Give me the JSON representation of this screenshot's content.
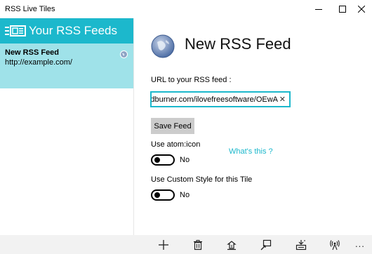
{
  "window": {
    "title": "RSS Live Tiles"
  },
  "sidebar": {
    "header_title": "Your RSS Feeds",
    "header_icon": "news-icon",
    "items": [
      {
        "name": "New RSS Feed",
        "url": "http://example.com/",
        "icon": "globe-icon"
      }
    ]
  },
  "main": {
    "title": "New RSS Feed",
    "url_label": "URL to your RSS feed :",
    "url_value": "http://feeds.feedburner.com/ilovefreesoftware/OEwA",
    "save_label": "Save Feed",
    "atom_label": "Use atom:icon",
    "whats_this": "What's this ?",
    "atom_state": "No",
    "custom_label": "Use Custom Style for this Tile",
    "custom_state": "No"
  },
  "appbar": {
    "icons": [
      "add-icon",
      "delete-icon",
      "pin-icon",
      "preview-icon",
      "tile-icon",
      "antenna-icon"
    ],
    "more": "..."
  },
  "colors": {
    "accent": "#1cb8cc",
    "selection": "#9fe2e9",
    "appbar": "#f2f2f2",
    "link": "#1cb8cc"
  }
}
